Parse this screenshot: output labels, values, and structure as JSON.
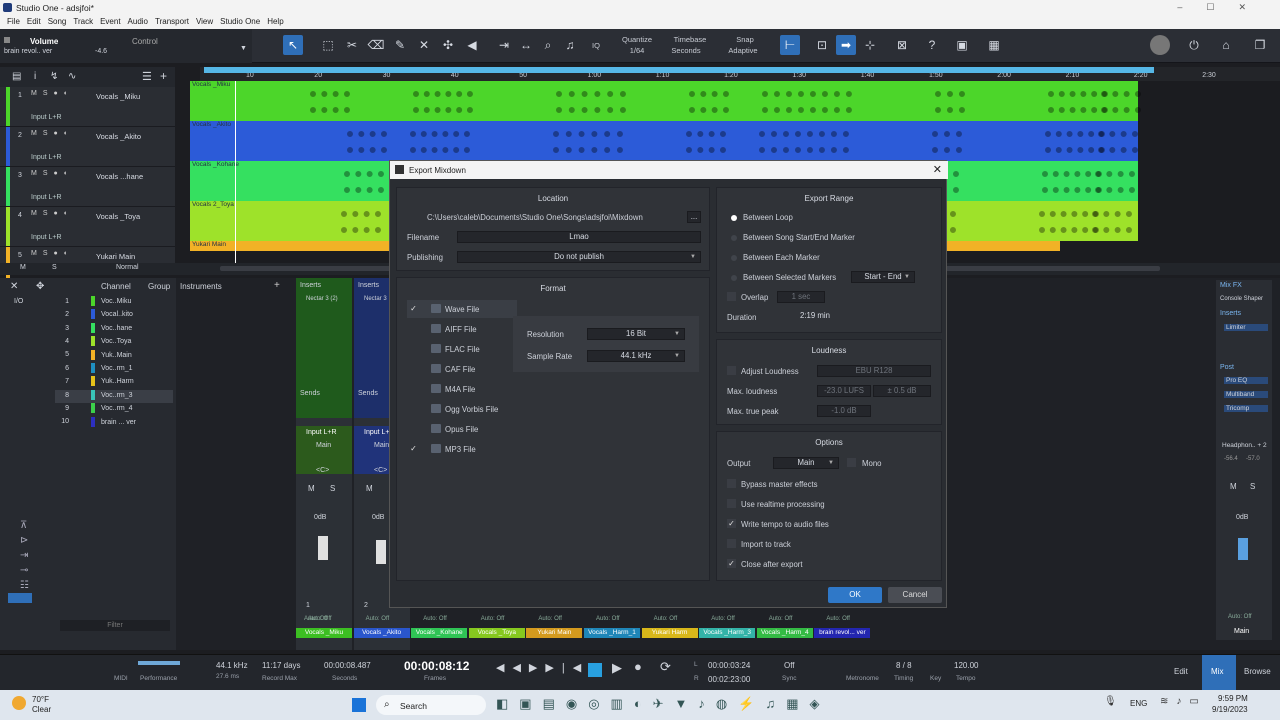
{
  "window": {
    "title": "Studio One - adsjfoi*"
  },
  "menu": [
    "File",
    "Edit",
    "Song",
    "Track",
    "Event",
    "Audio",
    "Transport",
    "View",
    "Studio One",
    "Help"
  ],
  "control_panel": {
    "param": "Volume",
    "section": "Control",
    "value": "-4.6",
    "track": "brain revol.. ver"
  },
  "toolbar": {
    "quantize_label": "Quantize",
    "quantize_value": "1/64",
    "timebase_label": "Timebase",
    "timebase_value": "Seconds",
    "snap_label": "Snap",
    "snap_value": "Adaptive",
    "iq": "IQ"
  },
  "ruler": [
    "10",
    "20",
    "30",
    "40",
    "50",
    "1:00",
    "1:10",
    "1:20",
    "1:30",
    "1:40",
    "1:50",
    "2:00",
    "2:10",
    "2:20",
    "2:30"
  ],
  "tracks": [
    {
      "num": "1",
      "name": "Vocals _Miku",
      "input": "Input L+R",
      "clip": "Vocals _Miku",
      "color": "#4cd62a"
    },
    {
      "num": "2",
      "name": "Vocals _Akito",
      "input": "Input L+R",
      "clip": "Vocals _Akito",
      "color": "#2c5bd8"
    },
    {
      "num": "3",
      "name": "Vocals ...hane",
      "input": "Input L+R",
      "clip": "Vocals _Kohane",
      "color": "#35e060"
    },
    {
      "num": "4",
      "name": "Vocals _Toya",
      "input": "Input L+R",
      "clip": "Vocals 2_Toya",
      "color": "#9ee22a"
    },
    {
      "num": "5",
      "name": "Yukari Main",
      "input": "",
      "clip": "Yukari Main",
      "color": "#f2b226"
    }
  ],
  "track_footer": {
    "m": "M",
    "s": "S",
    "mode": "Normal"
  },
  "channel_list": {
    "headers": [
      "Channel",
      "Group",
      "Instruments"
    ],
    "items": [
      {
        "num": "1",
        "name": "Voc..Miku",
        "color": "#4cd62a"
      },
      {
        "num": "2",
        "name": "Vocal..kito",
        "color": "#2c5bd8"
      },
      {
        "num": "3",
        "name": "Voc..hane",
        "color": "#35e060"
      },
      {
        "num": "4",
        "name": "Voc..Toya",
        "color": "#9ee22a"
      },
      {
        "num": "5",
        "name": "Yuk..Main",
        "color": "#f2b226"
      },
      {
        "num": "6",
        "name": "Voc..rm_1",
        "color": "#1f8fc0"
      },
      {
        "num": "7",
        "name": "Yuk..Harm",
        "color": "#e6c21a"
      },
      {
        "num": "8",
        "name": "Voc..rm_3",
        "color": "#39c4b8"
      },
      {
        "num": "9",
        "name": "Voc..rm_4",
        "color": "#3cd04a"
      },
      {
        "num": "10",
        "name": "brain ... ver",
        "color": "#2d2fc0"
      }
    ],
    "filter": "Filter"
  },
  "strips": {
    "inserts": "Inserts",
    "sends": "Sends",
    "plugin1": "Nectar 3 (2)",
    "plugin2": "Nectar 3",
    "input": "Input L+R",
    "bus": "Main",
    "pan": "<C>",
    "m": "M",
    "s": "S",
    "db": "0dB",
    "auto": "Auto: Off",
    "n1": "1",
    "n2": "2"
  },
  "strip_names": [
    {
      "name": "Vocals _Miku",
      "color": "#3cbf22"
    },
    {
      "name": "Vocals _Akito",
      "color": "#2a56cc"
    },
    {
      "name": "Vocals _Kohane",
      "color": "#2fc455"
    },
    {
      "name": "Vocals _Toya",
      "color": "#86c81f"
    },
    {
      "name": "Yukari Main",
      "color": "#d49a1e"
    },
    {
      "name": "Vocals _Harm_1",
      "color": "#1f86b8"
    },
    {
      "name": "Yukari Harm",
      "color": "#d8b71a"
    },
    {
      "name": "Vocals _Harm_3",
      "color": "#33b3a8"
    },
    {
      "name": "Vocals _Harm_4",
      "color": "#34bb44"
    },
    {
      "name": "brain revol... ver",
      "color": "#2326b0"
    }
  ],
  "right_panel": {
    "mixfx": "Mix FX",
    "console_shaper": "Console Shaper",
    "inserts": "Inserts",
    "limiter": "Limiter",
    "post": "Post",
    "pro_eq": "Pro EQ",
    "multiband": "Multiband",
    "tricomp": "Tricomp",
    "headphones": "Headphon.. + 2",
    "v1": "-56.4",
    "v2": "-57.0",
    "m": "M",
    "s": "S",
    "db": "0dB",
    "auto": "Auto: Off",
    "main": "Main"
  },
  "dialog": {
    "title": "Export Mixdown",
    "location_header": "Location",
    "path": "C:\\Users\\caleb\\Documents\\Studio One\\Songs\\adsjfoi\\Mixdown",
    "browse": "...",
    "filename_label": "Filename",
    "filename": "Lmao",
    "publishing_label": "Publishing",
    "publishing": "Do not publish",
    "format_header": "Format",
    "formats": [
      {
        "name": "Wave File",
        "checked": true
      },
      {
        "name": "AIFF File",
        "checked": false
      },
      {
        "name": "FLAC File",
        "checked": false
      },
      {
        "name": "CAF File",
        "checked": false
      },
      {
        "name": "M4A File",
        "checked": false
      },
      {
        "name": "Ogg Vorbis File",
        "checked": false
      },
      {
        "name": "Opus File",
        "checked": false
      },
      {
        "name": "MP3 File",
        "checked": true
      }
    ],
    "resolution_label": "Resolution",
    "resolution": "16 Bit",
    "samplerate_label": "Sample Rate",
    "samplerate": "44.1 kHz",
    "range_header": "Export Range",
    "ranges": [
      "Between Loop",
      "Between Song Start/End Marker",
      "Between Each Marker",
      "Between Selected Markers"
    ],
    "markers_select": "Start - End",
    "overlap_label": "Overlap",
    "overlap": "1 sec",
    "duration_label": "Duration",
    "duration": "2:19 min",
    "loudness_header": "Loudness",
    "adjust_loudness": "Adjust Loudness",
    "ebu": "EBU R128",
    "max_loudness_label": "Max. loudness",
    "max_loudness": "-23.0 LUFS",
    "tolerance": "± 0.5 dB",
    "max_peak_label": "Max. true peak",
    "max_peak": "-1.0 dB",
    "options_header": "Options",
    "output_label": "Output",
    "output": "Main",
    "mono": "Mono",
    "options": [
      {
        "label": "Bypass master effects",
        "checked": false
      },
      {
        "label": "Use realtime processing",
        "checked": false
      },
      {
        "label": "Write tempo to audio files",
        "checked": true
      },
      {
        "label": "Import to track",
        "checked": false
      },
      {
        "label": "Close after export",
        "checked": true
      }
    ],
    "ok": "OK",
    "cancel": "Cancel"
  },
  "transport": {
    "midi": "MIDI",
    "performance": "Performance",
    "samplerate": "44.1 kHz",
    "latency": "27.6 ms",
    "record_days": "11:17 days",
    "record_max": "Record Max",
    "seconds_val": "00:00:08.487",
    "seconds_lbl": "Seconds",
    "time": "00:00:08:12",
    "frames": "Frames",
    "l_time": "00:00:03:24",
    "r_time": "00:02:23:00",
    "l": "L",
    "r": "R",
    "sync_val": "Off",
    "sync": "Sync",
    "metronome": "Metronome",
    "timing_val": "8 / 8",
    "timing": "Timing",
    "key": "Key",
    "tempo_val": "120.00",
    "tempo": "Tempo",
    "edit": "Edit",
    "mix": "Mix",
    "browse": "Browse"
  },
  "taskbar": {
    "temp": "70°F",
    "weather": "Clear",
    "search": "Search",
    "lang": "ENG",
    "time": "9:59 PM",
    "date": "9/19/2023"
  }
}
